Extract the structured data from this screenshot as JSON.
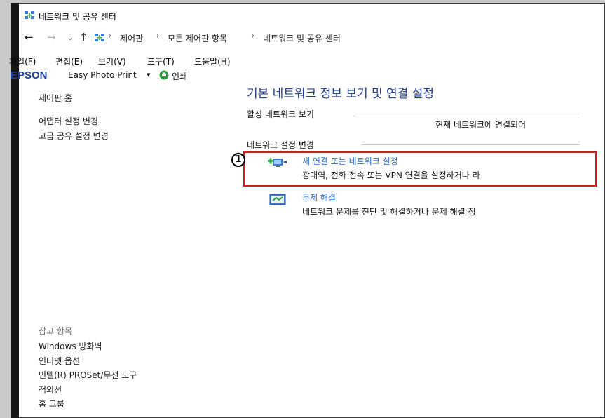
{
  "window": {
    "title": "네트워크 및 공유 센터"
  },
  "address_bar": {
    "back": "←",
    "forward": "→",
    "recent": "⌄",
    "up": "↑",
    "crumbs": [
      "제어판",
      "모든 제어판 항목",
      "네트워크 및 공유 센터"
    ],
    "separator": "›"
  },
  "menu": [
    "파일(F)",
    "편집(E)",
    "보기(V)",
    "도구(T)",
    "도움말(H)"
  ],
  "epson_bar": {
    "logo": "EPSON",
    "app": "Easy Photo Print",
    "dropdown": "▾",
    "print_label": "인쇄"
  },
  "sidebar": {
    "home": "제어판 홈",
    "links": [
      "어댑터 설정 변경",
      "고급 공유 설정 변경"
    ],
    "see_also_title": "참고 항목",
    "see_also": [
      "Windows 방화벽",
      "인터넷 옵션",
      "인텔(R) PROSet/무선 도구",
      "적외선",
      "홈 그룹"
    ]
  },
  "main": {
    "title": "기본 네트워크 정보 보기 및 연결 설정",
    "active_networks_heading": "활성 네트워크 보기",
    "not_connected": "현재 네트워크에 연결되어",
    "change_settings_heading": "네트워크 설정 변경",
    "tasks": [
      {
        "title": "새 연결 또는 네트워크 설정",
        "desc": "광대역, 전화 접속 또는 VPN 연결을 설정하거나 라"
      },
      {
        "title": "문제 해결",
        "desc": "네트워크 문제를 진단 및 해결하거나 문제 해결 정"
      }
    ]
  },
  "annotation": {
    "marker": "1"
  },
  "colors": {
    "highlight": "#d21b1b",
    "link": "#2c6bc7",
    "title": "#1f3f96",
    "epson": "#1b3f9a"
  }
}
